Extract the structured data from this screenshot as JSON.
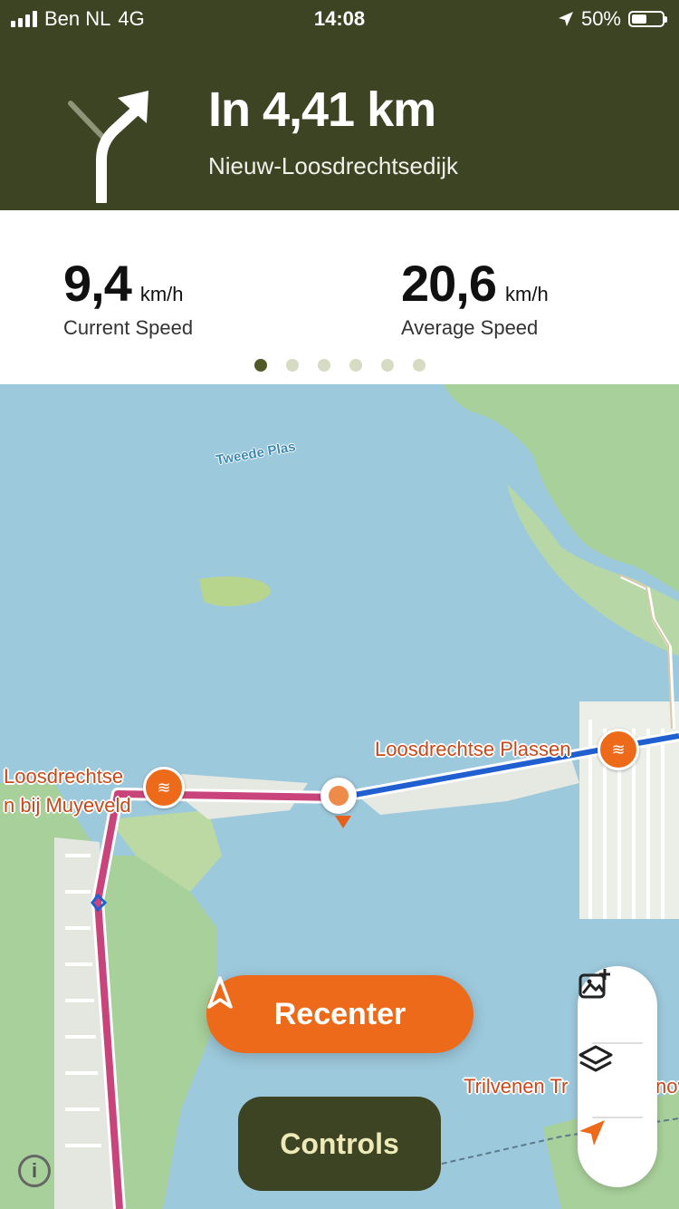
{
  "status_bar": {
    "carrier": "Ben NL",
    "network": "4G",
    "time": "14:08",
    "battery_percent": "50%",
    "battery_level": 0.5
  },
  "navigation": {
    "maneuver_icon": "turn-right-arrow-icon",
    "distance": "In 4,41 km",
    "street": "Nieuw-Loosdrechtsedijk"
  },
  "stats": {
    "current": {
      "value": "9,4",
      "unit": "km/h",
      "label": "Current Speed"
    },
    "average": {
      "value": "20,6",
      "unit": "km/h",
      "label": "Average Speed"
    },
    "pages": 6,
    "active_page": 1
  },
  "map": {
    "labels": {
      "water1": "Tweede Plas",
      "poi1_line1": "Loosdrechtse",
      "poi1_line2": "n bij Muyeveld",
      "poi2": "Loosdrechtse Plassen",
      "poi3": "Trilvenen Tr",
      "poi3_tail": "nov"
    },
    "poi_icon": "water-waves-icon"
  },
  "buttons": {
    "recenter": "Recenter",
    "controls": "Controls",
    "info": "i"
  },
  "colors": {
    "header_bg": "#3c4423",
    "accent": "#ec6a1a",
    "route_done": "#c8447a",
    "route_ahead": "#1f5fd0"
  },
  "icons": {
    "add_photo": "add-photo-icon",
    "layers": "layers-icon",
    "location": "location-arrow-icon"
  }
}
